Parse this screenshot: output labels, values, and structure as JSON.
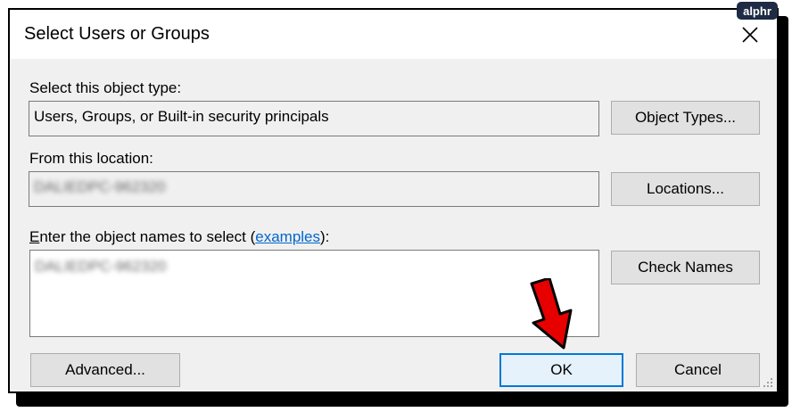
{
  "dialog": {
    "title": "Select Users or Groups",
    "object_type_label": "Select this object type:",
    "object_type_value": "Users, Groups, or Built-in security principals",
    "location_label": "From this location:",
    "location_value": "DALIEDPC-962320",
    "names_label_prefix": "Enter the object names to select (",
    "names_label_mnemonic": "E",
    "names_label_rest": "nter the object names to select (",
    "names_label_link": "examples",
    "names_label_suffix": "):",
    "names_value": "DALIEDPC-962320"
  },
  "buttons": {
    "object_types": "Object Types...",
    "locations": "Locations...",
    "check_names": "Check Names",
    "advanced": "Advanced...",
    "ok": "OK",
    "cancel": "Cancel"
  },
  "watermark": {
    "text": "alphr"
  },
  "colors": {
    "accent": "#0078d7",
    "link": "#0066cc",
    "arrow": "#e60000"
  }
}
